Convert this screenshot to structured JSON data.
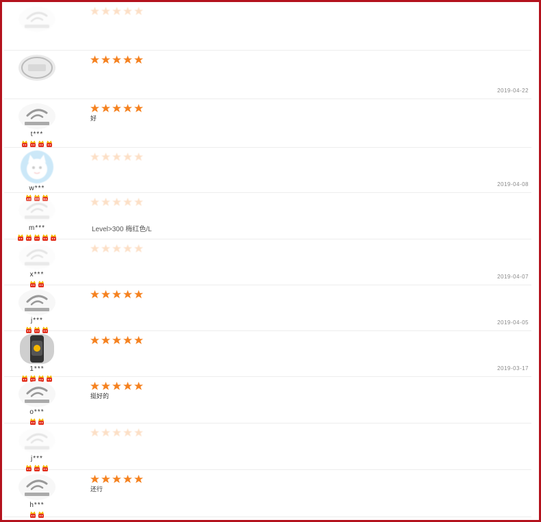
{
  "colors": {
    "frame": "#b3121d",
    "star": "#f58220",
    "badge_crown": "#f5b700",
    "badge_face": "#e2301e",
    "divider": "#ededed"
  },
  "reviews": [
    {
      "user": "",
      "badges": 0,
      "avatar": "default",
      "stars": 5,
      "content": "",
      "attrs": "",
      "date": "",
      "faded": true
    },
    {
      "user": "",
      "badges": 0,
      "avatar": "badge",
      "stars": 5,
      "content": "",
      "attrs": "",
      "date": "2019-04-22",
      "faded": false
    },
    {
      "user": "t***",
      "badges": 4,
      "avatar": "default",
      "stars": 5,
      "content": "好",
      "attrs": "",
      "date": "",
      "faded": false
    },
    {
      "user": "w***",
      "badges": 3,
      "avatar": "cat",
      "stars": 5,
      "content": "",
      "attrs": "",
      "date": "2019-04-08",
      "faded": true
    },
    {
      "user": "m***",
      "badges": 5,
      "avatar": "default",
      "stars": 5,
      "content": "",
      "attrs": "Level>300 梅红色/L",
      "date": "",
      "faded": true
    },
    {
      "user": "x***",
      "badges": 2,
      "avatar": "default",
      "stars": 5,
      "content": "",
      "attrs": "",
      "date": "2019-04-07",
      "faded": true
    },
    {
      "user": "j***",
      "badges": 3,
      "avatar": "default",
      "stars": 5,
      "content": "",
      "attrs": "",
      "date": "2019-04-05",
      "faded": false
    },
    {
      "user": "1***",
      "badges": 4,
      "avatar": "watch",
      "stars": 5,
      "content": "",
      "attrs": "",
      "date": "2019-03-17",
      "faded": false
    },
    {
      "user": "o***",
      "badges": 2,
      "avatar": "default",
      "stars": 5,
      "content": "挺好的",
      "attrs": "",
      "date": "",
      "faded": false
    },
    {
      "user": "j***",
      "badges": 3,
      "avatar": "default",
      "stars": 5,
      "content": "",
      "attrs": "",
      "date": "",
      "faded": true
    },
    {
      "user": "h***",
      "badges": 2,
      "avatar": "default",
      "stars": 5,
      "content": "还行",
      "attrs": "",
      "date": "",
      "faded": false
    }
  ]
}
